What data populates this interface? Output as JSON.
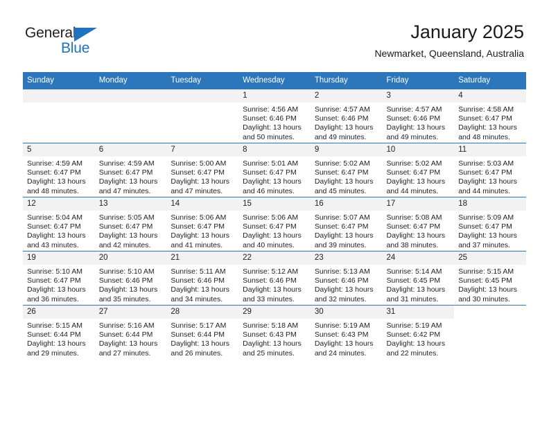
{
  "brand": {
    "name_top": "General",
    "name_bottom": "Blue",
    "color_blue": "#1f72bd",
    "color_dark": "#231f20"
  },
  "header": {
    "title": "January 2025",
    "subtitle": "Newmarket, Queensland, Australia"
  },
  "theme": {
    "header_row_bg": "#2c76bc",
    "daynum_bg": "#f2f2f2",
    "grid_line": "#2c76bc",
    "text": "#222222"
  },
  "weekday_headers": [
    "Sunday",
    "Monday",
    "Tuesday",
    "Wednesday",
    "Thursday",
    "Friday",
    "Saturday"
  ],
  "labels": {
    "sunrise_prefix": "Sunrise:",
    "sunset_prefix": "Sunset:",
    "daylight_prefix": "Daylight:"
  },
  "weeks": [
    [
      {
        "day": "",
        "blank": true
      },
      {
        "day": "",
        "blank": true
      },
      {
        "day": "",
        "blank": true
      },
      {
        "day": "1",
        "sunrise": "Sunrise: 4:56 AM",
        "sunset": "Sunset: 6:46 PM",
        "daylight_line1": "Daylight: 13 hours",
        "daylight_line2": "and 50 minutes."
      },
      {
        "day": "2",
        "sunrise": "Sunrise: 4:57 AM",
        "sunset": "Sunset: 6:46 PM",
        "daylight_line1": "Daylight: 13 hours",
        "daylight_line2": "and 49 minutes."
      },
      {
        "day": "3",
        "sunrise": "Sunrise: 4:57 AM",
        "sunset": "Sunset: 6:46 PM",
        "daylight_line1": "Daylight: 13 hours",
        "daylight_line2": "and 49 minutes."
      },
      {
        "day": "4",
        "sunrise": "Sunrise: 4:58 AM",
        "sunset": "Sunset: 6:47 PM",
        "daylight_line1": "Daylight: 13 hours",
        "daylight_line2": "and 48 minutes."
      }
    ],
    [
      {
        "day": "5",
        "sunrise": "Sunrise: 4:59 AM",
        "sunset": "Sunset: 6:47 PM",
        "daylight_line1": "Daylight: 13 hours",
        "daylight_line2": "and 48 minutes."
      },
      {
        "day": "6",
        "sunrise": "Sunrise: 4:59 AM",
        "sunset": "Sunset: 6:47 PM",
        "daylight_line1": "Daylight: 13 hours",
        "daylight_line2": "and 47 minutes."
      },
      {
        "day": "7",
        "sunrise": "Sunrise: 5:00 AM",
        "sunset": "Sunset: 6:47 PM",
        "daylight_line1": "Daylight: 13 hours",
        "daylight_line2": "and 47 minutes."
      },
      {
        "day": "8",
        "sunrise": "Sunrise: 5:01 AM",
        "sunset": "Sunset: 6:47 PM",
        "daylight_line1": "Daylight: 13 hours",
        "daylight_line2": "and 46 minutes."
      },
      {
        "day": "9",
        "sunrise": "Sunrise: 5:02 AM",
        "sunset": "Sunset: 6:47 PM",
        "daylight_line1": "Daylight: 13 hours",
        "daylight_line2": "and 45 minutes."
      },
      {
        "day": "10",
        "sunrise": "Sunrise: 5:02 AM",
        "sunset": "Sunset: 6:47 PM",
        "daylight_line1": "Daylight: 13 hours",
        "daylight_line2": "and 44 minutes."
      },
      {
        "day": "11",
        "sunrise": "Sunrise: 5:03 AM",
        "sunset": "Sunset: 6:47 PM",
        "daylight_line1": "Daylight: 13 hours",
        "daylight_line2": "and 44 minutes."
      }
    ],
    [
      {
        "day": "12",
        "sunrise": "Sunrise: 5:04 AM",
        "sunset": "Sunset: 6:47 PM",
        "daylight_line1": "Daylight: 13 hours",
        "daylight_line2": "and 43 minutes."
      },
      {
        "day": "13",
        "sunrise": "Sunrise: 5:05 AM",
        "sunset": "Sunset: 6:47 PM",
        "daylight_line1": "Daylight: 13 hours",
        "daylight_line2": "and 42 minutes."
      },
      {
        "day": "14",
        "sunrise": "Sunrise: 5:06 AM",
        "sunset": "Sunset: 6:47 PM",
        "daylight_line1": "Daylight: 13 hours",
        "daylight_line2": "and 41 minutes."
      },
      {
        "day": "15",
        "sunrise": "Sunrise: 5:06 AM",
        "sunset": "Sunset: 6:47 PM",
        "daylight_line1": "Daylight: 13 hours",
        "daylight_line2": "and 40 minutes."
      },
      {
        "day": "16",
        "sunrise": "Sunrise: 5:07 AM",
        "sunset": "Sunset: 6:47 PM",
        "daylight_line1": "Daylight: 13 hours",
        "daylight_line2": "and 39 minutes."
      },
      {
        "day": "17",
        "sunrise": "Sunrise: 5:08 AM",
        "sunset": "Sunset: 6:47 PM",
        "daylight_line1": "Daylight: 13 hours",
        "daylight_line2": "and 38 minutes."
      },
      {
        "day": "18",
        "sunrise": "Sunrise: 5:09 AM",
        "sunset": "Sunset: 6:47 PM",
        "daylight_line1": "Daylight: 13 hours",
        "daylight_line2": "and 37 minutes."
      }
    ],
    [
      {
        "day": "19",
        "sunrise": "Sunrise: 5:10 AM",
        "sunset": "Sunset: 6:47 PM",
        "daylight_line1": "Daylight: 13 hours",
        "daylight_line2": "and 36 minutes."
      },
      {
        "day": "20",
        "sunrise": "Sunrise: 5:10 AM",
        "sunset": "Sunset: 6:46 PM",
        "daylight_line1": "Daylight: 13 hours",
        "daylight_line2": "and 35 minutes."
      },
      {
        "day": "21",
        "sunrise": "Sunrise: 5:11 AM",
        "sunset": "Sunset: 6:46 PM",
        "daylight_line1": "Daylight: 13 hours",
        "daylight_line2": "and 34 minutes."
      },
      {
        "day": "22",
        "sunrise": "Sunrise: 5:12 AM",
        "sunset": "Sunset: 6:46 PM",
        "daylight_line1": "Daylight: 13 hours",
        "daylight_line2": "and 33 minutes."
      },
      {
        "day": "23",
        "sunrise": "Sunrise: 5:13 AM",
        "sunset": "Sunset: 6:46 PM",
        "daylight_line1": "Daylight: 13 hours",
        "daylight_line2": "and 32 minutes."
      },
      {
        "day": "24",
        "sunrise": "Sunrise: 5:14 AM",
        "sunset": "Sunset: 6:45 PM",
        "daylight_line1": "Daylight: 13 hours",
        "daylight_line2": "and 31 minutes."
      },
      {
        "day": "25",
        "sunrise": "Sunrise: 5:15 AM",
        "sunset": "Sunset: 6:45 PM",
        "daylight_line1": "Daylight: 13 hours",
        "daylight_line2": "and 30 minutes."
      }
    ],
    [
      {
        "day": "26",
        "sunrise": "Sunrise: 5:15 AM",
        "sunset": "Sunset: 6:44 PM",
        "daylight_line1": "Daylight: 13 hours",
        "daylight_line2": "and 29 minutes."
      },
      {
        "day": "27",
        "sunrise": "Sunrise: 5:16 AM",
        "sunset": "Sunset: 6:44 PM",
        "daylight_line1": "Daylight: 13 hours",
        "daylight_line2": "and 27 minutes."
      },
      {
        "day": "28",
        "sunrise": "Sunrise: 5:17 AM",
        "sunset": "Sunset: 6:44 PM",
        "daylight_line1": "Daylight: 13 hours",
        "daylight_line2": "and 26 minutes."
      },
      {
        "day": "29",
        "sunrise": "Sunrise: 5:18 AM",
        "sunset": "Sunset: 6:43 PM",
        "daylight_line1": "Daylight: 13 hours",
        "daylight_line2": "and 25 minutes."
      },
      {
        "day": "30",
        "sunrise": "Sunrise: 5:19 AM",
        "sunset": "Sunset: 6:43 PM",
        "daylight_line1": "Daylight: 13 hours",
        "daylight_line2": "and 24 minutes."
      },
      {
        "day": "31",
        "sunrise": "Sunrise: 5:19 AM",
        "sunset": "Sunset: 6:42 PM",
        "daylight_line1": "Daylight: 13 hours",
        "daylight_line2": "and 22 minutes."
      },
      {
        "day": "",
        "blank": true,
        "trailing": true
      }
    ]
  ]
}
